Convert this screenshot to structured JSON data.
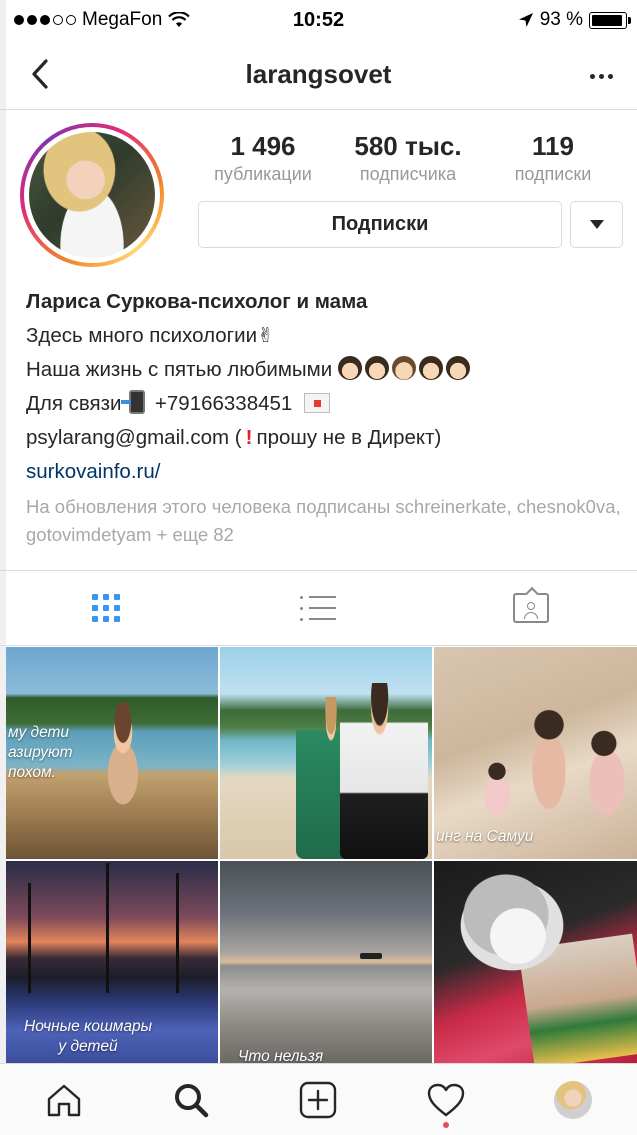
{
  "status_bar": {
    "carrier": "MegaFon",
    "time": "10:52",
    "battery": "93 %",
    "battery_level": 0.93
  },
  "nav": {
    "title": "larangsovet"
  },
  "profile": {
    "stats": [
      {
        "value": "1 496",
        "label": "публикации"
      },
      {
        "value": "580 тыс.",
        "label": "подписчика"
      },
      {
        "value": "119",
        "label": "подписки"
      }
    ],
    "follow_button": "Подписки",
    "name": "Лариса Суркова-психолог и мама",
    "bio": {
      "line1": "Здесь много психологии",
      "line2": "Наша жизнь с пятью любимыми",
      "line3_prefix": "Для связи",
      "line3_phone": "+79166338451",
      "line4_email": "psylarang@gmail.com (",
      "line4_suffix": "прошу не в Директ)",
      "link": "surkovainfo.ru/"
    },
    "followed_by": "На обновления этого человека подписаны schreinerkate, chesnok0va, gotovimdetyam + еще 82"
  },
  "tabs": [
    {
      "name": "grid",
      "active": true
    },
    {
      "name": "list",
      "active": false
    },
    {
      "name": "tagged",
      "active": false
    }
  ],
  "posts": [
    {
      "caption": "му дети\nазируют\nпохом."
    },
    {
      "caption": ""
    },
    {
      "caption": "инг на Самуи"
    },
    {
      "caption": "Ночные кошмары\nу детей"
    },
    {
      "caption": "Что нельзя"
    },
    {
      "caption": ""
    }
  ],
  "tab_bar": [
    {
      "icon": "home-icon"
    },
    {
      "icon": "search-icon"
    },
    {
      "icon": "add-post-icon"
    },
    {
      "icon": "heart-icon"
    },
    {
      "icon": "profile-avatar"
    }
  ],
  "colors": {
    "accent": "#3897f0",
    "link": "#003569",
    "muted": "#999999",
    "notification": "#ed4956"
  }
}
